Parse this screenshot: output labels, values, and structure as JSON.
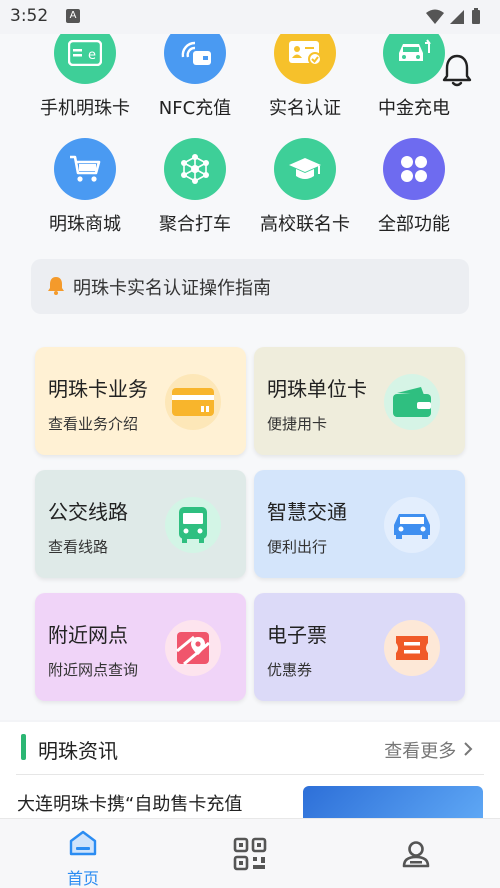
{
  "status_bar": {
    "time": "3:52",
    "notification_glyph": "A"
  },
  "colors": {
    "accent_blue": "#2b8cf2",
    "green_icon": "#3ecf98",
    "blue_icon": "#4a9af2",
    "yellow_icon": "#f6c12b",
    "purple_icon": "#6e6bf0"
  },
  "quick_grid": [
    {
      "label": "手机明珠卡",
      "icon": "card-e-icon"
    },
    {
      "label": "NFC充值",
      "icon": "nfc-icon"
    },
    {
      "label": "实名认证",
      "icon": "id-verify-icon"
    },
    {
      "label": "中金充电",
      "icon": "ev-charge-icon"
    },
    {
      "label": "明珠商城",
      "icon": "cart-icon"
    },
    {
      "label": "聚合打车",
      "icon": "network-icon"
    },
    {
      "label": "高校联名卡",
      "icon": "graduation-cap-icon"
    },
    {
      "label": "全部功能",
      "icon": "all-functions-icon"
    }
  ],
  "notice": {
    "text": "明珠卡实名认证操作指南"
  },
  "service_cards": [
    {
      "title": "明珠卡业务",
      "subtitle": "查看业务介绍",
      "icon": "bank-card-icon"
    },
    {
      "title": "明珠单位卡",
      "subtitle": "便捷用卡",
      "icon": "wallet-icon"
    },
    {
      "title": "公交线路",
      "subtitle": "查看线路",
      "icon": "bus-icon"
    },
    {
      "title": "智慧交通",
      "subtitle": "便利出行",
      "icon": "car-icon"
    },
    {
      "title": "附近网点",
      "subtitle": "附近网点查询",
      "icon": "map-pin-icon"
    },
    {
      "title": "电子票",
      "subtitle": "优惠券",
      "icon": "ticket-icon"
    }
  ],
  "news": {
    "title": "明珠资讯",
    "more": "查看更多",
    "first_item": "大连明珠卡携“自助售卡充值"
  },
  "tabbar": {
    "home_label": "首页"
  }
}
